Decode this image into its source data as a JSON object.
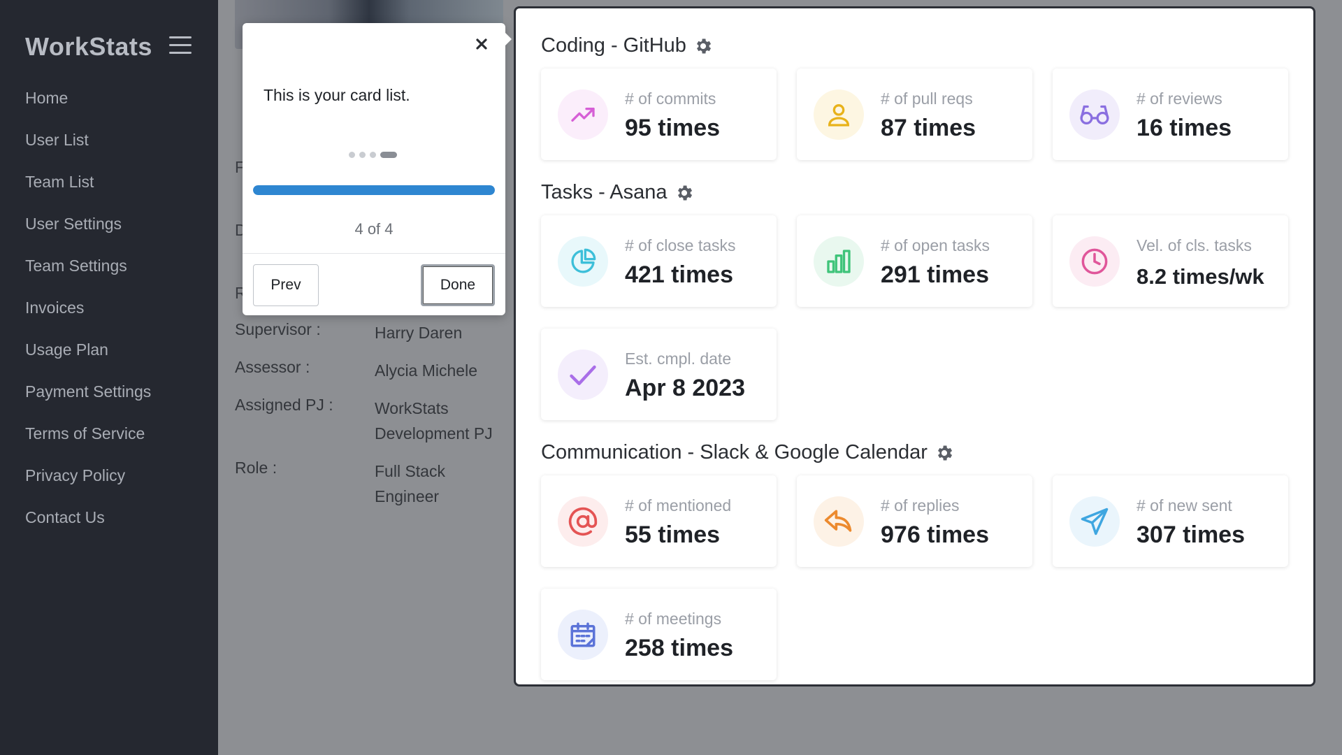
{
  "app": {
    "brand": "WorkStats"
  },
  "sidebar": {
    "items": [
      {
        "label": "Home"
      },
      {
        "label": "User List"
      },
      {
        "label": "Team List"
      },
      {
        "label": "User Settings"
      },
      {
        "label": "Team Settings"
      },
      {
        "label": "Invoices"
      },
      {
        "label": "Usage Plan"
      },
      {
        "label": "Payment Settings"
      },
      {
        "label": "Terms of Service"
      },
      {
        "label": "Privacy Policy"
      },
      {
        "label": "Contact Us"
      }
    ]
  },
  "profile": {
    "edge_letters": [
      "F",
      "D",
      "R"
    ],
    "rows": [
      {
        "label": "Supervisor :",
        "value": "Harry Daren"
      },
      {
        "label": "Assessor :",
        "value": "Alycia Michele"
      },
      {
        "label": "Assigned PJ :",
        "value": "WorkStats Development PJ"
      },
      {
        "label": "Role :",
        "value": "Full Stack Engineer"
      }
    ]
  },
  "sections": [
    {
      "title": "Coding - GitHub",
      "cards": [
        {
          "label": "# of commits",
          "value": "95 times",
          "icon": "trending-up-icon",
          "color": "#d65fd6",
          "bg": "#fbeefb"
        },
        {
          "label": "# of pull reqs",
          "value": "87 times",
          "icon": "user-icon",
          "color": "#e8b21a",
          "bg": "#fdf6e2"
        },
        {
          "label": "# of reviews",
          "value": "16 times",
          "icon": "glasses-icon",
          "color": "#8a6fe0",
          "bg": "#f1edfb"
        }
      ]
    },
    {
      "title": "Tasks - Asana",
      "cards": [
        {
          "label": "# of close tasks",
          "value": "421 times",
          "icon": "pie-chart-icon",
          "color": "#3dbfd9",
          "bg": "#e8f8fb"
        },
        {
          "label": "# of open tasks",
          "value": "291 times",
          "icon": "bar-chart-icon",
          "color": "#3fc47a",
          "bg": "#e9f8ef"
        },
        {
          "label": "Vel. of cls. tasks",
          "value": "8.2 times/wk",
          "icon": "clock-icon",
          "color": "#e0569a",
          "bg": "#fcecf3"
        },
        {
          "label": "Est. cmpl. date",
          "value": "Apr 8 2023",
          "icon": "check-icon",
          "color": "#a96ee8",
          "bg": "#f4eefc"
        }
      ]
    },
    {
      "title": "Communication - Slack & Google Calendar",
      "cards": [
        {
          "label": "# of mentioned",
          "value": "55 times",
          "icon": "at-sign-icon",
          "color": "#e45454",
          "bg": "#fdeded"
        },
        {
          "label": "# of replies",
          "value": "976 times",
          "icon": "reply-icon",
          "color": "#ec8a2e",
          "bg": "#fdf2e6"
        },
        {
          "label": "# of new sent",
          "value": "307 times",
          "icon": "send-icon",
          "color": "#3fa6e0",
          "bg": "#eaf5fc"
        },
        {
          "label": "# of meetings",
          "value": "258 times",
          "icon": "calendar-icon",
          "color": "#5b73d8",
          "bg": "#ecf0fc"
        }
      ]
    }
  ],
  "tour": {
    "message": "This is your card list.",
    "step": 4,
    "total": 4,
    "counter": "4 of 4",
    "progress": 1.0,
    "prev_label": "Prev",
    "done_label": "Done"
  }
}
